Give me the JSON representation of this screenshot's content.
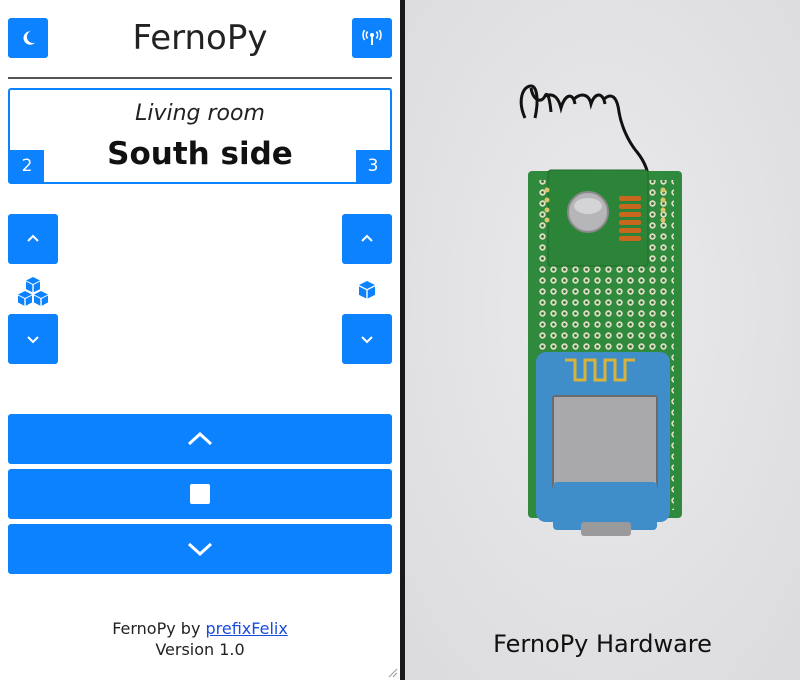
{
  "header": {
    "title": "FernoPy",
    "theme_toggle_icon": "moon-icon",
    "connection_icon": "antenna-icon"
  },
  "selector": {
    "room": "Living room",
    "group": "South side",
    "left_badge": "2",
    "right_badge": "3"
  },
  "steppers": {
    "left": {
      "up_icon": "chevron-up-icon",
      "mode_icon": "cubes-icon",
      "down_icon": "chevron-down-icon"
    },
    "right": {
      "up_icon": "chevron-up-icon",
      "mode_icon": "cube-icon",
      "down_icon": "chevron-down-icon"
    }
  },
  "controls": {
    "up_icon": "chevron-up-icon",
    "stop_icon": "stop-icon",
    "down_icon": "chevron-down-icon"
  },
  "footer": {
    "prefix": "FernoPy by ",
    "author_link": "prefixFelix",
    "version": "Version 1.0"
  },
  "hardware": {
    "caption": "FernoPy Hardware"
  },
  "colors": {
    "accent": "#0d82ff",
    "divider": "#1a1a1a"
  }
}
